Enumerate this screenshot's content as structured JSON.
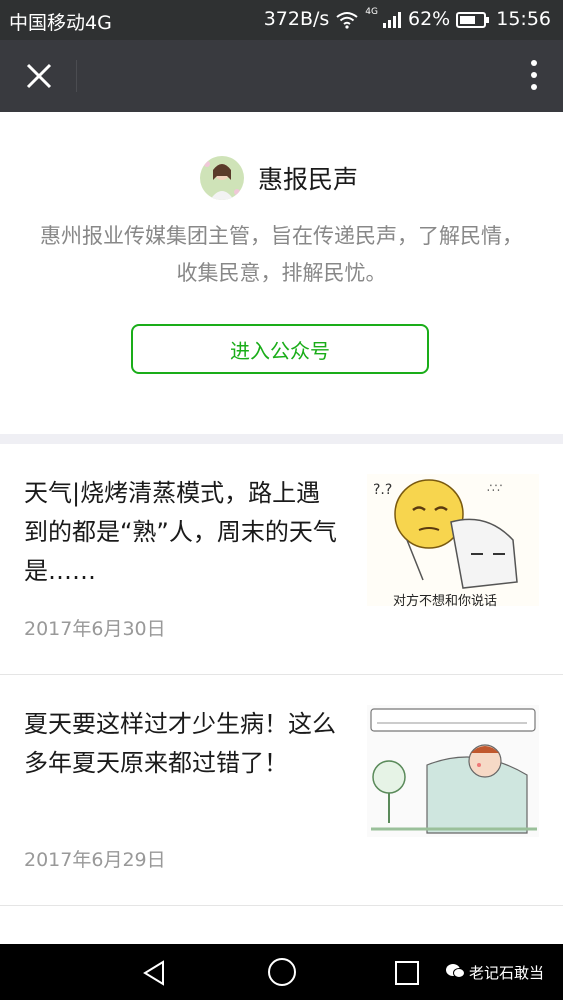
{
  "status_bar": {
    "carrier": "中国移动4G",
    "speed": "372B/s",
    "net_type": "4G",
    "battery": "62%",
    "time": "15:56"
  },
  "account": {
    "name": "惠报民声",
    "description": "惠州报业传媒集团主管，旨在传递民声，了解民情，收集民意，排解民忧。",
    "enter_button": "进入公众号"
  },
  "articles": [
    {
      "title": "天气|烧烤清蒸模式，路上遇到的都是“熟”人，周末的天气是……",
      "date": "2017年6月30日",
      "thumb_caption": "对方不想和你说话"
    },
    {
      "title": "夏天要这样过才少生病！这么多年夏天原来都过错了！",
      "date": "2017年6月29日"
    }
  ],
  "watermark": "老记石敢当",
  "colors": {
    "accent": "#1aad19",
    "nav_bg": "#393a3f",
    "status_bg": "#2f3132"
  }
}
